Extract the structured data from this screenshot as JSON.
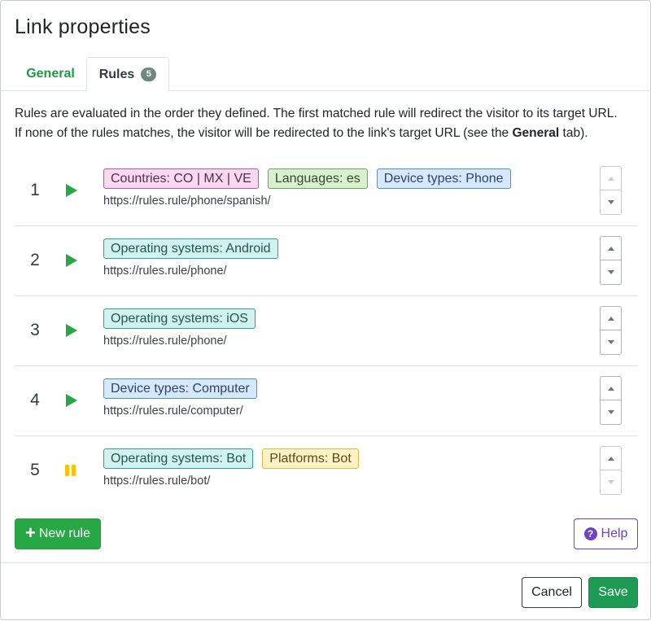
{
  "dialog": {
    "title": "Link properties"
  },
  "tabs": [
    {
      "label": "General",
      "active": false
    },
    {
      "label": "Rules",
      "badge": "5",
      "active": true
    }
  ],
  "intro": {
    "line1": "Rules are evaluated in the order they defined. The first matched rule will redirect the visitor to its target URL.",
    "line2_before": "If none of the rules matches, the visitor will be redirected to the link's target URL (see the ",
    "line2_bold": "General",
    "line2_after": " tab)."
  },
  "rules": [
    {
      "number": "1",
      "state": "play-icon",
      "url": "https://rules.rule/phone/spanish/",
      "conditions": [
        {
          "text": "Countries: CO | MX | VE",
          "color": "#f9d9ef"
        },
        {
          "text": "Languages: es",
          "color": "#d9f0cf"
        },
        {
          "text": "Device types: Phone",
          "color": "#d6e8fb"
        }
      ]
    },
    {
      "number": "2",
      "state": "play-icon",
      "url": "https://rules.rule/phone/",
      "conditions": [
        {
          "text": "Operating systems: Android",
          "color": "#d1f2ef"
        }
      ]
    },
    {
      "number": "3",
      "state": "play-icon",
      "url": "https://rules.rule/phone/",
      "conditions": [
        {
          "text": "Operating systems: iOS",
          "color": "#d1f2ef"
        }
      ]
    },
    {
      "number": "4",
      "state": "play-icon",
      "url": "https://rules.rule/computer/",
      "conditions": [
        {
          "text": "Device types: Computer",
          "color": "#d6e8fb"
        }
      ]
    },
    {
      "number": "5",
      "state": "pause-icon",
      "url": "https://rules.rule/bot/",
      "conditions": [
        {
          "text": "Operating systems: Bot",
          "color": "#d1f2ef"
        },
        {
          "text": "Platforms: Bot",
          "color": "#fdf2c6"
        }
      ]
    }
  ],
  "actions": {
    "new_rule": "New rule",
    "help": "Help"
  },
  "footer": {
    "cancel": "Cancel",
    "save": "Save"
  },
  "colors": {
    "accent_green": "#28a745",
    "help_purple": "#6f42c1",
    "pause_yellow": "#ffc107"
  }
}
